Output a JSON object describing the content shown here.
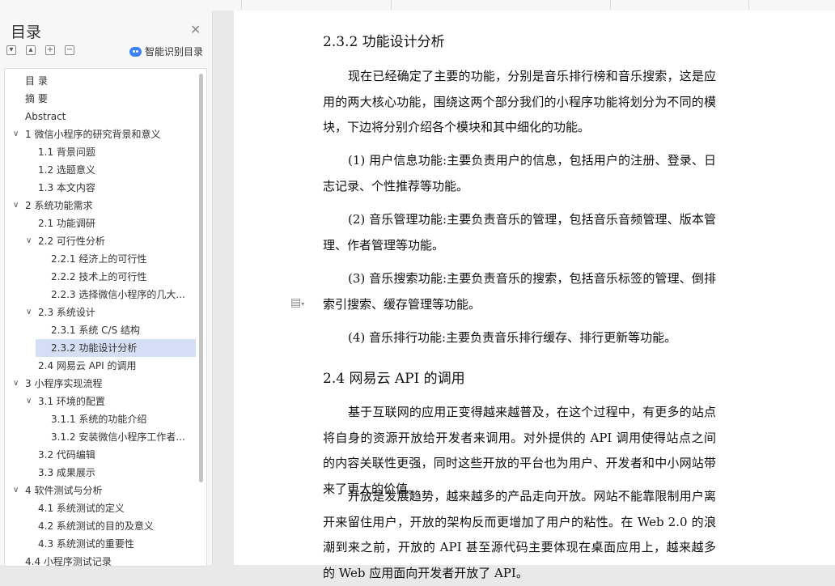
{
  "toc": {
    "title": "目录",
    "smart_label": "智能识别目录",
    "items": [
      {
        "label": "目  录"
      },
      {
        "label": "摘  要"
      },
      {
        "label": "Abstract"
      },
      {
        "label": "1  微信小程序的研究背景和意义"
      },
      {
        "label": "1.1  背景问题"
      },
      {
        "label": "1.2  选题意义"
      },
      {
        "label": "1.3  本文内容"
      },
      {
        "label": "2  系统功能需求"
      },
      {
        "label": "2.1  功能调研"
      },
      {
        "label": "2.2  可行性分析"
      },
      {
        "label": "2.2.1  经济上的可行性"
      },
      {
        "label": "2.2.2  技术上的可行性"
      },
      {
        "label": "2.2.3  选择微信小程序的几大..."
      },
      {
        "label": "2.3  系统设计"
      },
      {
        "label": "2.3.1    系统 C/S 结构"
      },
      {
        "label": "2.3.2  功能设计分析"
      },
      {
        "label": "2.4  网易云 API 的调用"
      },
      {
        "label": "3  小程序实现流程"
      },
      {
        "label": "3.1  环境的配置"
      },
      {
        "label": "3.1.1  系统的功能介绍"
      },
      {
        "label": "3.1.2  安装微信小程序工作者..."
      },
      {
        "label": "3.2  代码编辑"
      },
      {
        "label": "3.3  成果展示"
      },
      {
        "label": "4    软件测试与分析"
      },
      {
        "label": "4.1    系统测试的定义"
      },
      {
        "label": "4.2    系统测试的目的及意义"
      },
      {
        "label": "4.3    系统测试的重要性"
      },
      {
        "label": "4.4  小程序测试记录"
      }
    ]
  },
  "doc": {
    "h1": "2.3.2  功能设计分析",
    "p1": "现在已经确定了主要的功能，分别是音乐排行榜和音乐搜索，这是应用的两大核心功能，围绕这两个部分我们的小程序功能将划分为不同的模块，下边将分别介绍各个模块和其中细化的功能。",
    "p2": "(1) 用户信息功能:主要负责用户的信息，包括用户的注册、登录、日志记录、个性推荐等功能。",
    "p3": "(2) 音乐管理功能:主要负责音乐的管理，包括音乐音频管理、版本管理、作者管理等功能。",
    "p4": "(3) 音乐搜索功能:主要负责音乐的搜索，包括音乐标签的管理、倒排索引搜索、缓存管理等功能。",
    "p5": "(4) 音乐排行功能:主要负责音乐排行缓存、排行更新等功能。",
    "h2": "2.4  网易云 API 的调用",
    "p6": "基于互联网的应用正变得越来越普及，在这个过程中，有更多的站点将自身的资源开放给开发者来调用。对外提供的 API 调用使得站点之间的内容关联性更强，同时这些开放的平台也为用户、开发者和中小网站带来了更大的价值。",
    "p7": "开放是发展趋势，越来越多的产品走向开放。网站不能靠限制用户离开来留住用户，开放的架构反而更增加了用户的粘性。在 Web 2.0 的浪潮到来之前，开放的 API 甚至源代码主要体现在桌面应用上，越来越多的 Web 应用面向开发者开放了 API。"
  }
}
